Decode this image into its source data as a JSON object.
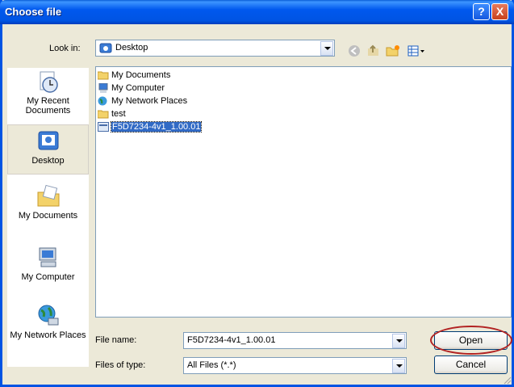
{
  "title": "Choose file",
  "look_in": {
    "label": "Look in:",
    "value": "Desktop"
  },
  "places": [
    {
      "label": "My Recent Documents",
      "icon": "recent-documents-icon"
    },
    {
      "label": "Desktop",
      "icon": "desktop-icon",
      "selected": true
    },
    {
      "label": "My Documents",
      "icon": "my-documents-icon"
    },
    {
      "label": "My Computer",
      "icon": "my-computer-icon"
    },
    {
      "label": "My Network Places",
      "icon": "network-places-icon"
    }
  ],
  "files": [
    {
      "name": "My Documents",
      "icon": "folder-docs-icon"
    },
    {
      "name": "My Computer",
      "icon": "computer-icon"
    },
    {
      "name": "My Network Places",
      "icon": "network-icon"
    },
    {
      "name": "test",
      "icon": "folder-icon"
    },
    {
      "name": "F5D7234-4v1_1.00.01",
      "icon": "file-icon",
      "selected": true
    }
  ],
  "file_name": {
    "label": "File name:",
    "value": "F5D7234-4v1_1.00.01"
  },
  "file_type": {
    "label": "Files of type:",
    "value": "All Files (*.*)"
  },
  "buttons": {
    "open": "Open",
    "cancel": "Cancel",
    "help": "?",
    "close": "X"
  }
}
